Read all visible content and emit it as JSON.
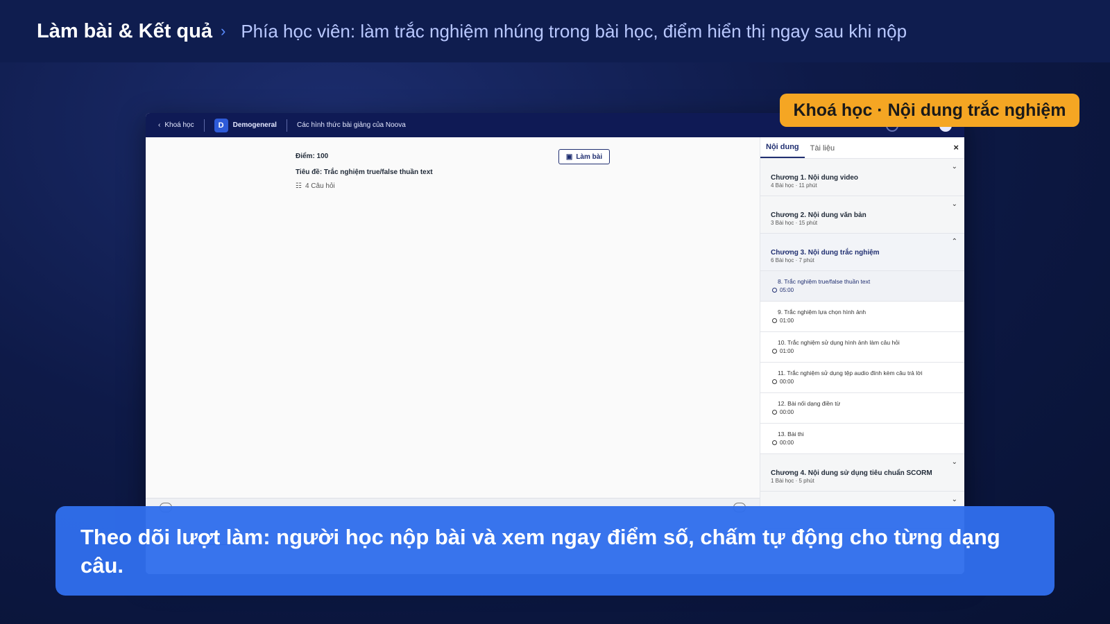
{
  "banner": {
    "title": "Làm bài & Kết quả",
    "separator": "›",
    "subtitle": "Phía học viên: làm trắc nghiệm nhúng trong bài học, điểm hiển thị ngay sau khi nộp"
  },
  "tag": {
    "label": "Khoá học · Nội dung trắc nghiệm",
    "color": "#f5a623"
  },
  "caption": {
    "text": "Theo dõi lượt làm: người học nộp bài và xem ngay điểm số, chấm tự động cho từng dạng câu."
  },
  "app": {
    "header": {
      "back_label": "Khoá học",
      "brand_initial": "D",
      "brand_name": "Demogeneral",
      "course_title": "Các hình thức bài giảng của Noova"
    },
    "main": {
      "score": "Điểm: 100",
      "quiz_title": "Tiêu đề: Trắc nghiệm true/false thuần text",
      "question_count": "4 Câu hỏi",
      "do_button": "Làm bài"
    },
    "sidebar": {
      "tabs": [
        "Nội dung",
        "Tài liệu"
      ],
      "close": "×",
      "chapters_before": [
        {
          "title": "Chương 1. Nội dung video",
          "meta": "4 Bài học · 11 phút"
        },
        {
          "title": "Chương 2. Nội dung văn bản",
          "meta": "3 Bài học · 15 phút"
        }
      ],
      "open_chapter": {
        "title": "Chương 3. Nội dung trắc nghiệm",
        "meta": "6 Bài học · 7 phút"
      },
      "lessons": [
        {
          "title": "8. Trắc nghiệm true/false thuần text",
          "time": "05:00"
        },
        {
          "title": "9. Trắc nghiệm lựa chọn hình ảnh",
          "time": "01:00"
        },
        {
          "title": "10. Trắc nghiệm sử dụng hình ảnh làm câu hỏi",
          "time": "01:00"
        },
        {
          "title": "11. Trắc nghiệm sử dụng tệp audio đính kèm câu trả lời",
          "time": "00:00"
        },
        {
          "title": "12. Bài nối dạng điền từ",
          "time": "00:00"
        },
        {
          "title": "13. Bài thi",
          "time": "00:00"
        }
      ],
      "chapter_after": {
        "title": "Chương 4. Nội dung sử dụng tiêu chuẩn SCORM",
        "meta": "1 Bài học · 5 phút"
      }
    }
  }
}
